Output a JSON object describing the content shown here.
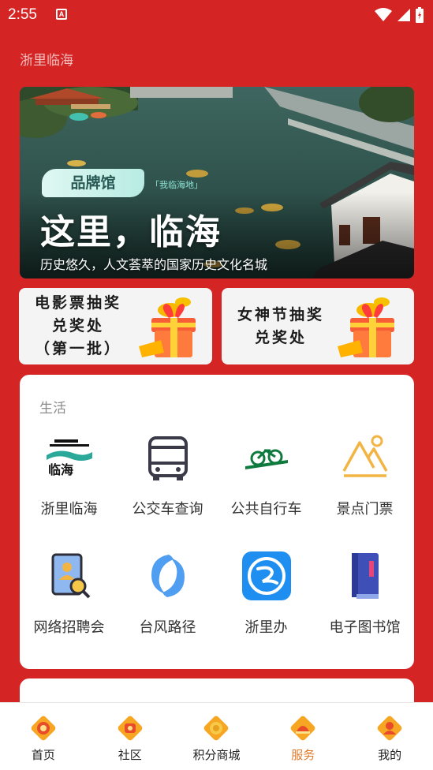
{
  "status_bar": {
    "time": "2:55",
    "app_icon_letter": "A"
  },
  "app": {
    "title": "浙里临海"
  },
  "banner": {
    "badge": "品牌馆",
    "badge_sub": "「我临海地」",
    "headline": "这里，临海",
    "caption": "历史悠久，人文荟萃的国家历史文化名城"
  },
  "promos": [
    {
      "lines": [
        "电影票抽奖",
        "兑奖处",
        "（第一批）"
      ]
    },
    {
      "lines": [
        "女神节抽奖",
        "兑奖处"
      ]
    }
  ],
  "life": {
    "title": "生活",
    "items": [
      {
        "label": "浙里临海",
        "icon": "zheli-linhai-logo-icon"
      },
      {
        "label": "公交车查询",
        "icon": "bus-icon"
      },
      {
        "label": "公共自行车",
        "icon": "bicycle-icon"
      },
      {
        "label": "景点门票",
        "icon": "mountain-ticket-icon"
      },
      {
        "label": "网络招聘会",
        "icon": "recruitment-icon"
      },
      {
        "label": "台风路径",
        "icon": "typhoon-icon"
      },
      {
        "label": "浙里办",
        "icon": "zheliban-icon"
      },
      {
        "label": "电子图书馆",
        "icon": "ebook-library-icon"
      }
    ]
  },
  "next_section_partial": "",
  "bottom_nav": {
    "active": "服务",
    "items": [
      {
        "label": "首页"
      },
      {
        "label": "社区"
      },
      {
        "label": "积分商城"
      },
      {
        "label": "服务"
      },
      {
        "label": "我的"
      }
    ]
  },
  "colors": {
    "background": "#d42424",
    "active_tab": "#e07a2b",
    "card": "#ffffff"
  }
}
